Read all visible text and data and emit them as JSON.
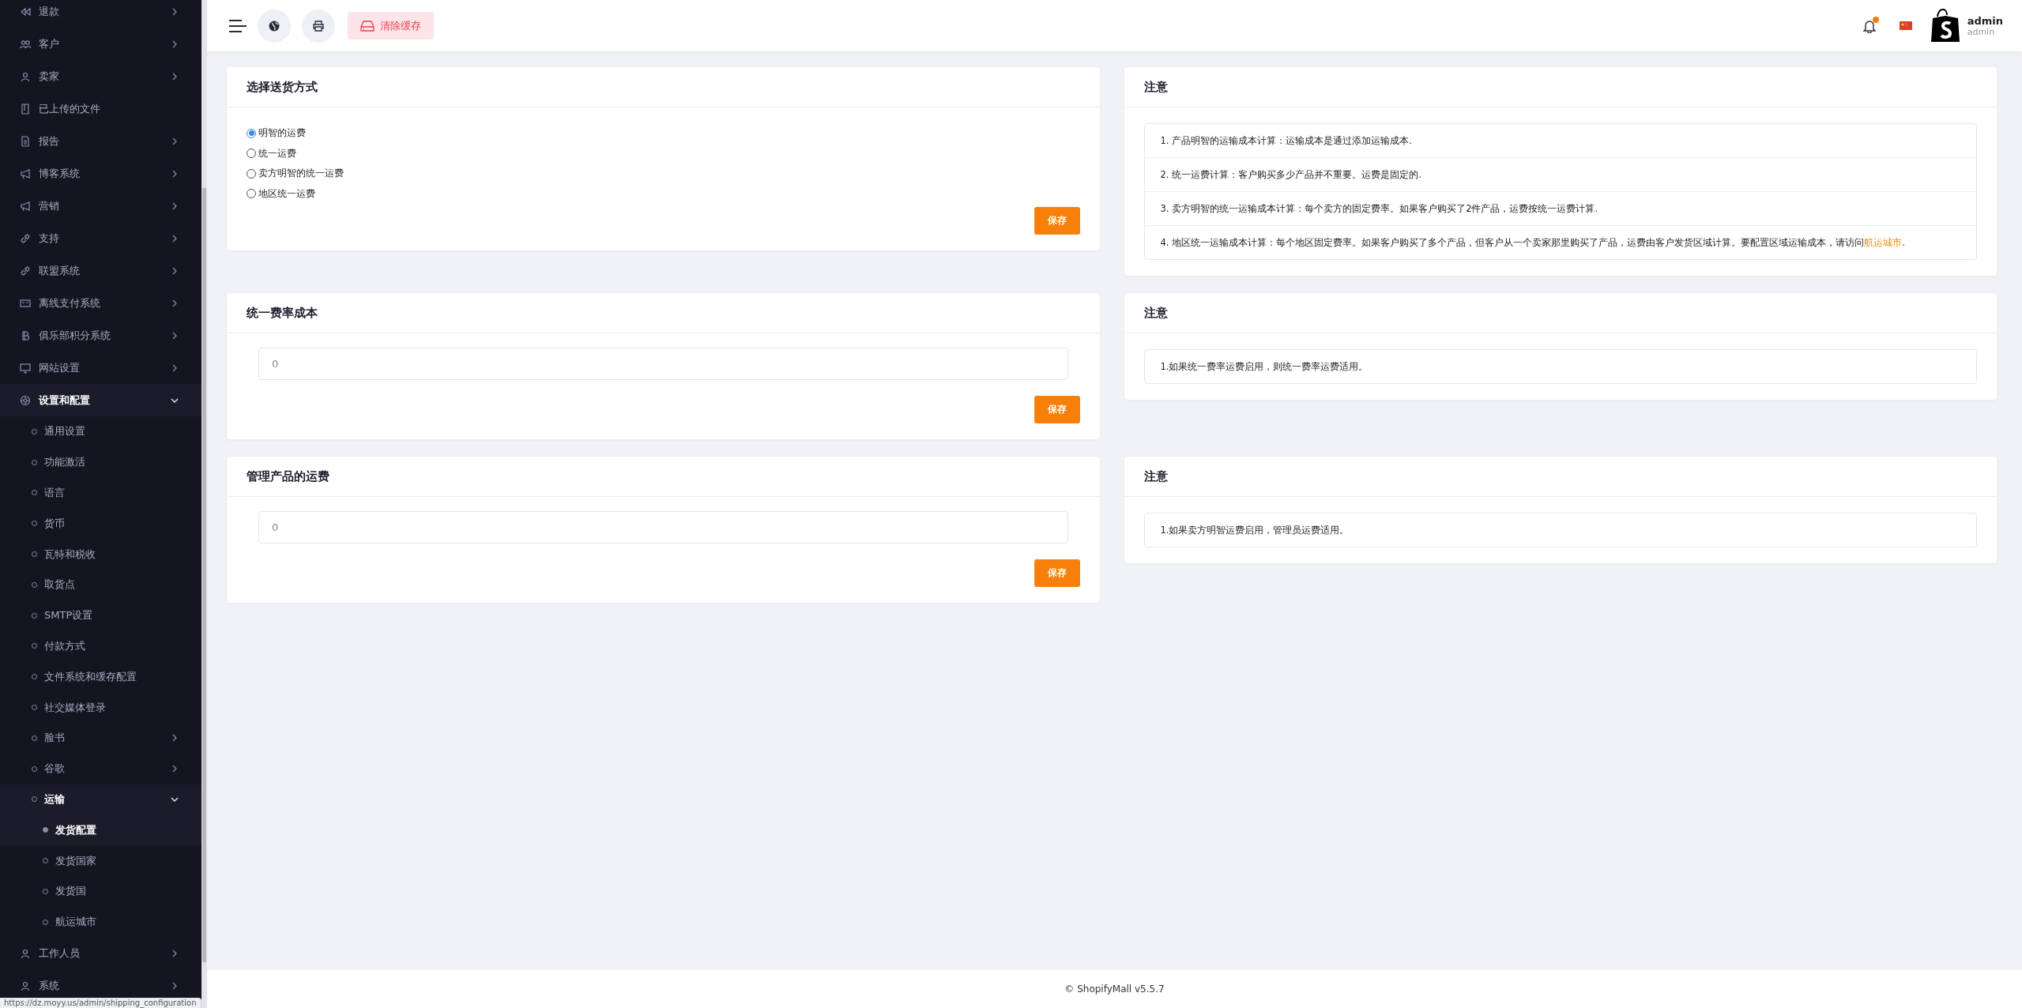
{
  "sidebar": {
    "items": [
      {
        "label": "退款",
        "has_submenu": true,
        "expanded": false
      },
      {
        "label": "客户",
        "has_submenu": true,
        "expanded": false
      },
      {
        "label": "卖家",
        "has_submenu": true,
        "expanded": false
      },
      {
        "label": "已上传的文件",
        "has_submenu": false,
        "expanded": false
      },
      {
        "label": "报告",
        "has_submenu": true,
        "expanded": false
      },
      {
        "label": "博客系统",
        "has_submenu": true,
        "expanded": false
      },
      {
        "label": "营销",
        "has_submenu": true,
        "expanded": false
      },
      {
        "label": "支持",
        "has_submenu": true,
        "expanded": false
      },
      {
        "label": "联盟系统",
        "has_submenu": true,
        "expanded": false
      },
      {
        "label": "离线支付系统",
        "has_submenu": true,
        "expanded": false
      },
      {
        "label": "俱乐部积分系统",
        "has_submenu": true,
        "expanded": false
      },
      {
        "label": "网站设置",
        "has_submenu": true,
        "expanded": false
      },
      {
        "label": "设置和配置",
        "has_submenu": true,
        "expanded": true,
        "children": [
          {
            "label": "通用设置",
            "has_submenu": false,
            "expanded": false
          },
          {
            "label": "功能激活",
            "has_submenu": false,
            "expanded": false
          },
          {
            "label": "语言",
            "has_submenu": false,
            "expanded": false
          },
          {
            "label": "货币",
            "has_submenu": false,
            "expanded": false
          },
          {
            "label": "瓦特和税收",
            "has_submenu": false,
            "expanded": false
          },
          {
            "label": "取货点",
            "has_submenu": false,
            "expanded": false
          },
          {
            "label": "SMTP设置",
            "has_submenu": false,
            "expanded": false
          },
          {
            "label": "付款方式",
            "has_submenu": false,
            "expanded": false
          },
          {
            "label": "文件系统和缓存配置",
            "has_submenu": false,
            "expanded": false
          },
          {
            "label": "社交媒体登录",
            "has_submenu": false,
            "expanded": false
          },
          {
            "label": "脸书",
            "has_submenu": true,
            "expanded": false
          },
          {
            "label": "谷歌",
            "has_submenu": true,
            "expanded": false
          },
          {
            "label": "运输",
            "has_submenu": true,
            "expanded": true,
            "children": [
              {
                "label": "发货配置",
                "selected": true
              },
              {
                "label": "发货国家",
                "selected": false
              },
              {
                "label": "发货国",
                "selected": false
              },
              {
                "label": "航运城市",
                "selected": false
              }
            ]
          }
        ]
      },
      {
        "label": "工作人员",
        "has_submenu": true,
        "expanded": false
      },
      {
        "label": "系统",
        "has_submenu": true,
        "expanded": false
      }
    ]
  },
  "topbar": {
    "clear_cache": "清除缓存",
    "notification_dot": true,
    "user": {
      "name": "admin",
      "role": "admin"
    }
  },
  "left_cards": [
    {
      "kind": "radios",
      "title": "选择送货方式",
      "options": [
        {
          "label": "明智的运费",
          "selected": true
        },
        {
          "label": "统一运费",
          "selected": false
        },
        {
          "label": "卖方明智的统一运费",
          "selected": false
        },
        {
          "label": "地区统一运费",
          "selected": false
        }
      ],
      "button": "保存"
    },
    {
      "kind": "input",
      "title": "统一费率成本",
      "placeholder": "0",
      "button": "保存"
    },
    {
      "kind": "input",
      "title": "管理产品的运费",
      "placeholder": "0",
      "button": "保存"
    }
  ],
  "note_cards": [
    {
      "title": "注意",
      "notes": [
        {
          "text": "1. 产品明智的运输成本计算：运输成本是通过添加运输成本."
        },
        {
          "text": "2. 统一运费计算：客户购买多少产品并不重要。运费是固定的."
        },
        {
          "text": "3. 卖方明智的统一运输成本计算：每个卖方的固定费率。如果客户购买了2件产品，运费按统一运费计算."
        },
        {
          "text": "4. 地区统一运输成本计算：每个地区固定费率。如果客户购买了多个产品，但客户从一个卖家那里购买了产品，运费由客户发货区域计算。要配置区域运输成本，请访问",
          "link": "航运城市",
          "after": "."
        }
      ]
    },
    {
      "title": "注意",
      "notes": [
        {
          "text": "1.如果统一费率运费启用，则统一费率运费适用。"
        }
      ]
    },
    {
      "title": "注意",
      "notes": [
        {
          "text": "1.如果卖方明智运费启用，管理员运费适用。"
        }
      ]
    }
  ],
  "footer": "© ShopifyMall v5.5.7",
  "status_url": "https://dz.moyy.us/admin/shipping_configuration"
}
